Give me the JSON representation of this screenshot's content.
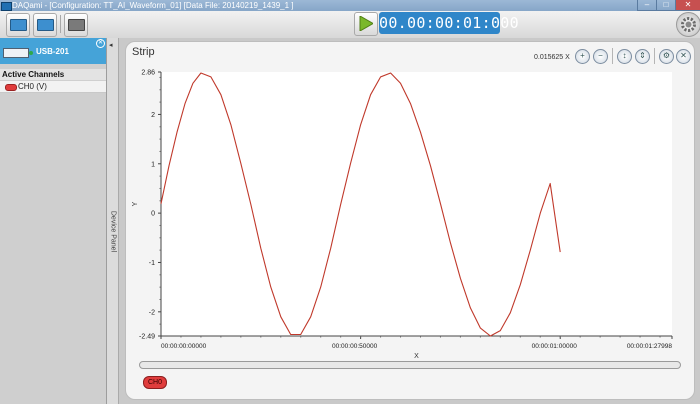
{
  "window": {
    "title": "DAQami - [Configuration: TT_AI_Waveform_01] [Data File: 20140219_1439_1 ]",
    "controls": [
      "–",
      "□",
      "✕"
    ]
  },
  "toolbar": {
    "timer": "00.00:00:01:000",
    "buttons": [
      "add-device",
      "add-channel",
      "display-panel"
    ]
  },
  "device_panel": {
    "device_name": "USB-201",
    "active_channels_label": "Active Channels",
    "channels": [
      {
        "label": "CH0 (V)",
        "color": "#e03c3c"
      }
    ],
    "side_tab_label": "Device Panel"
  },
  "strip": {
    "title": "Strip",
    "zoom": "0.015625 X",
    "legend_chip": "CH0"
  },
  "chart_data": {
    "type": "line",
    "title": "Strip",
    "xlabel": "X",
    "ylabel": "Y",
    "ylim": [
      -2.49,
      2.86
    ],
    "xlim": [
      0,
      1.27998
    ],
    "grid": false,
    "y_ticks": [
      {
        "v": 2.86,
        "label": "2.86"
      },
      {
        "v": 2,
        "label": "2"
      },
      {
        "v": 1,
        "label": "1"
      },
      {
        "v": 0,
        "label": "0"
      },
      {
        "v": -1,
        "label": "-1"
      },
      {
        "v": -2,
        "label": "-2"
      },
      {
        "v": -2.49,
        "label": "-2.49"
      }
    ],
    "x_ticks": [
      {
        "v": 0,
        "label": "00:00:00:00000"
      },
      {
        "v": 0.5,
        "label": "00:00:00:50000"
      },
      {
        "v": 1.0,
        "label": "00:00:01:00000"
      },
      {
        "v": 1.27998,
        "label": "00:00:01:27998"
      }
    ],
    "series": [
      {
        "name": "CH0",
        "color": "#c0392b",
        "x": [
          0,
          0.02,
          0.04,
          0.06,
          0.08,
          0.1,
          0.125,
          0.15,
          0.175,
          0.2,
          0.225,
          0.25,
          0.275,
          0.3,
          0.325,
          0.35,
          0.375,
          0.4,
          0.425,
          0.45,
          0.475,
          0.5,
          0.525,
          0.55,
          0.575,
          0.6,
          0.625,
          0.65,
          0.675,
          0.7,
          0.725,
          0.75,
          0.775,
          0.8,
          0.825,
          0.85,
          0.875,
          0.9,
          0.925,
          0.95,
          0.975,
          1.0
        ],
        "y": [
          0.19,
          0.96,
          1.64,
          2.22,
          2.63,
          2.84,
          2.76,
          2.4,
          1.79,
          1.01,
          0.18,
          -0.71,
          -1.5,
          -2.1,
          -2.46,
          -2.46,
          -2.1,
          -1.5,
          -0.71,
          0.18,
          1.01,
          1.79,
          2.4,
          2.76,
          2.84,
          2.63,
          2.22,
          1.64,
          0.96,
          0.19,
          -0.6,
          -1.32,
          -1.92,
          -2.33,
          -2.49,
          -2.38,
          -2.02,
          -1.45,
          -0.75,
          -0.0,
          0.6,
          -0.79
        ]
      }
    ]
  }
}
